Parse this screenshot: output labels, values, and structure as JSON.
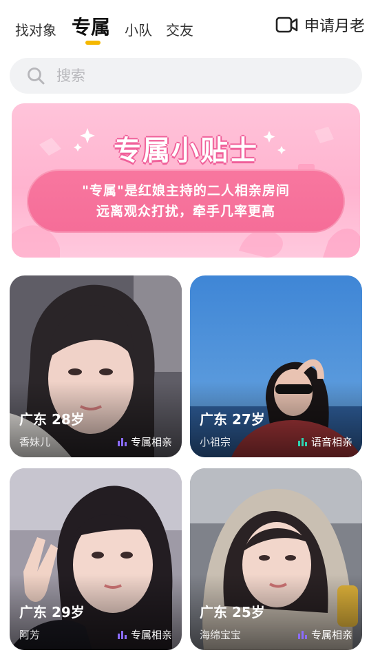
{
  "tabs": [
    {
      "label": "找对象",
      "active": false
    },
    {
      "label": "专属",
      "active": true
    },
    {
      "label": "小队",
      "active": false
    },
    {
      "label": "交友",
      "active": false
    }
  ],
  "header": {
    "apply_label": "申请月老",
    "apply_icon": "video-camera-icon"
  },
  "search": {
    "placeholder": "搜索",
    "icon": "search-icon"
  },
  "banner": {
    "title": "专属小贴士",
    "line1": "\"专属\"是红娘主持的二人相亲房间",
    "line2": "远离观众打扰，牵手几率更高"
  },
  "cards": [
    {
      "location": "广东 28岁",
      "nickname": "香妹儿",
      "mode": "专属相亲",
      "mode_color": "#8b6cff"
    },
    {
      "location": "广东 27岁",
      "nickname": "小祖宗",
      "mode": "语音相亲",
      "mode_color": "#2ed3b0"
    },
    {
      "location": "广东 29岁",
      "nickname": "阿芳",
      "mode": "专属相亲",
      "mode_color": "#8b6cff"
    },
    {
      "location": "广东 25岁",
      "nickname": "海绵宝宝",
      "mode": "专属相亲",
      "mode_color": "#8b6cff"
    }
  ],
  "colors": {
    "accent": "#f5b800",
    "banner_pink": "#f56d98"
  }
}
